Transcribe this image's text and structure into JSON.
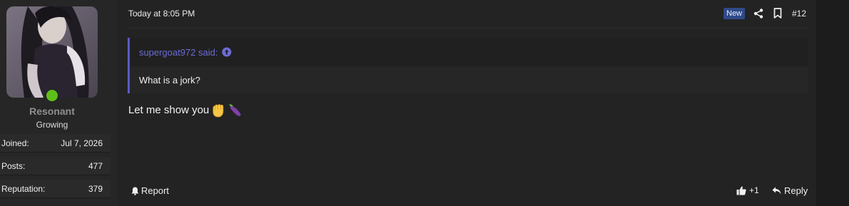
{
  "user": {
    "name": "Resonant",
    "title": "Growing",
    "stats": [
      {
        "label": "Joined:",
        "value": "Jul 7, 2026"
      },
      {
        "label": "Posts:",
        "value": "477"
      },
      {
        "label": "Reputation:",
        "value": "379"
      }
    ],
    "status_color": "#5fbf1a",
    "avatar_icon": "user-avatar-image"
  },
  "post": {
    "timestamp": "Today at 8:05 PM",
    "new_badge": "New",
    "number": "#12",
    "quote": {
      "author_line": "supergoat972 said:",
      "text": "What is a jork?"
    },
    "message": "Let me show you",
    "emojis": [
      "raised-fist-emoji",
      "eggplant-emoji"
    ]
  },
  "actions": {
    "report": "Report",
    "like_count": "+1",
    "reply": "Reply"
  },
  "colors": {
    "quote_accent": "#5a5ac8",
    "link": "#6b6bd6",
    "badge_bg": "#2f4a8a"
  }
}
